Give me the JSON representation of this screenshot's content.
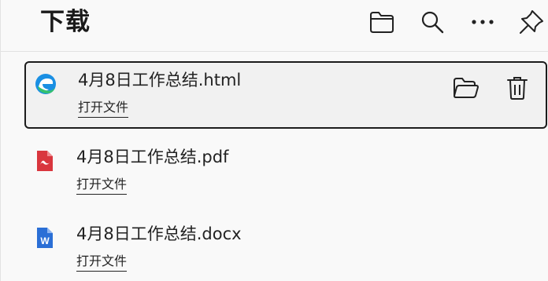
{
  "header": {
    "title": "下载",
    "buttons": [
      "folder-icon",
      "search-icon",
      "more-icon",
      "pin-icon"
    ]
  },
  "downloads": [
    {
      "filename": "4月8日工作总结.html",
      "action": "打开文件",
      "icon": "edge-browser-icon",
      "selected": true
    },
    {
      "filename": "4月8日工作总结.pdf",
      "action": "打开文件",
      "icon": "pdf-icon",
      "selected": false
    },
    {
      "filename": "4月8日工作总结.docx",
      "action": "打开文件",
      "icon": "word-icon",
      "selected": false
    }
  ],
  "colors": {
    "pdf": "#d9363e",
    "word": "#2b6fd6",
    "edge": "#1a8fe3",
    "selected_border": "#1c1c1c"
  }
}
